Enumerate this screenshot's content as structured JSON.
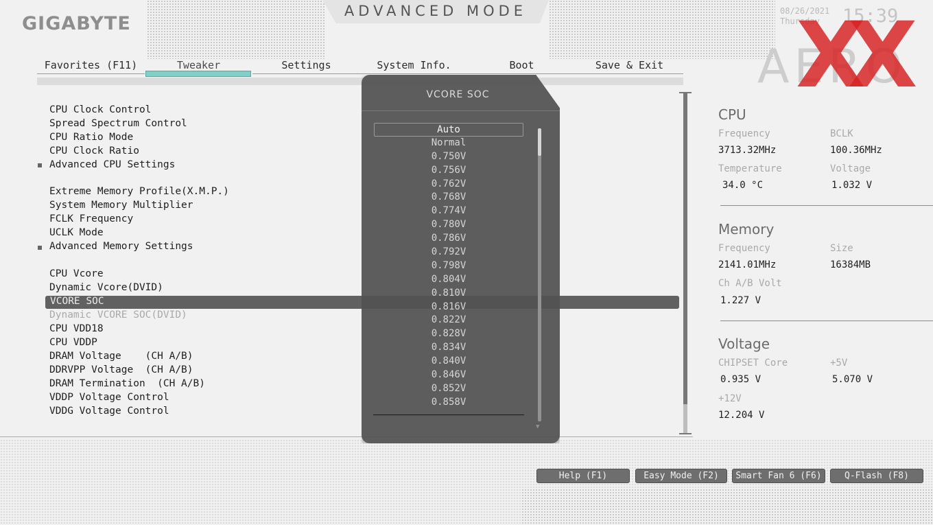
{
  "header": {
    "brand": "GIGABYTE",
    "mode_title": "ADVANCED MODE",
    "date": "08/26/2021",
    "day": "Thursday",
    "time": "15:39",
    "series_logo": "AERO",
    "watermark": "XX"
  },
  "tabs": [
    {
      "label": "Favorites (F11)",
      "active": false
    },
    {
      "label": "Tweaker",
      "active": true
    },
    {
      "label": "Settings",
      "active": false
    },
    {
      "label": "System Info.",
      "active": false
    },
    {
      "label": "Boot",
      "active": false
    },
    {
      "label": "Save & Exit",
      "active": false
    }
  ],
  "menu": [
    {
      "label": "CPU Clock Control"
    },
    {
      "label": "Spread Spectrum Control"
    },
    {
      "label": "CPU Ratio Mode"
    },
    {
      "label": "CPU Clock Ratio"
    },
    {
      "label": "Advanced CPU Settings",
      "submenu": true
    },
    {
      "label": "Extreme Memory Profile(X.M.P.)"
    },
    {
      "label": "System Memory Multiplier"
    },
    {
      "label": "FCLK Frequency"
    },
    {
      "label": "UCLK Mode"
    },
    {
      "label": "Advanced Memory Settings",
      "submenu": true
    },
    {
      "label": "CPU Vcore"
    },
    {
      "label": "Dynamic Vcore(DVID)"
    },
    {
      "label": "VCORE SOC",
      "selected": true
    },
    {
      "label": "Dynamic VCORE SOC(DVID)",
      "disabled": true
    },
    {
      "label": "CPU VDD18"
    },
    {
      "label": "CPU VDDP"
    },
    {
      "label": "DRAM Voltage    (CH A/B)"
    },
    {
      "label": "DDRVPP Voltage  (CH A/B)"
    },
    {
      "label": "DRAM Termination  (CH A/B)"
    },
    {
      "label": "VDDP Voltage Control"
    },
    {
      "label": "VDDG Voltage Control"
    }
  ],
  "popup": {
    "title": "VCORE SOC",
    "selected": "Auto",
    "options": [
      "Auto",
      "Normal",
      "0.750V",
      "0.756V",
      "0.762V",
      "0.768V",
      "0.774V",
      "0.780V",
      "0.786V",
      "0.792V",
      "0.798V",
      "0.804V",
      "0.810V",
      "0.816V",
      "0.822V",
      "0.828V",
      "0.834V",
      "0.840V",
      "0.846V",
      "0.852V",
      "0.858V"
    ]
  },
  "side": {
    "cpu": {
      "title": "CPU",
      "frequency_label": "Frequency",
      "frequency": "3713.32MHz",
      "bclk_label": "BCLK",
      "bclk": "100.36MHz",
      "temperature_label": "Temperature",
      "temperature": "34.0 °C",
      "voltage_label": "Voltage",
      "voltage": "1.032 V"
    },
    "memory": {
      "title": "Memory",
      "frequency_label": "Frequency",
      "frequency": "2141.01MHz",
      "size_label": "Size",
      "size": "16384MB",
      "volt_label": "Ch A/B Volt",
      "volt": "1.227 V"
    },
    "voltage": {
      "title": "Voltage",
      "chipset_label": "CHIPSET Core",
      "chipset": "0.935 V",
      "v5_label": "+5V",
      "v5": "5.070 V",
      "v12_label": "+12V",
      "v12": "12.204 V"
    }
  },
  "footer": {
    "help": "Help (F1)",
    "easy_mode": "Easy Mode (F2)",
    "smart_fan": "Smart Fan 6 (F6)",
    "qflash": "Q-Flash (F8)"
  },
  "colors": {
    "tab_accent": "#7fd1c7",
    "selection_bar": "#616161",
    "popup_bg": "#525252",
    "watermark_red": "#d62424"
  }
}
